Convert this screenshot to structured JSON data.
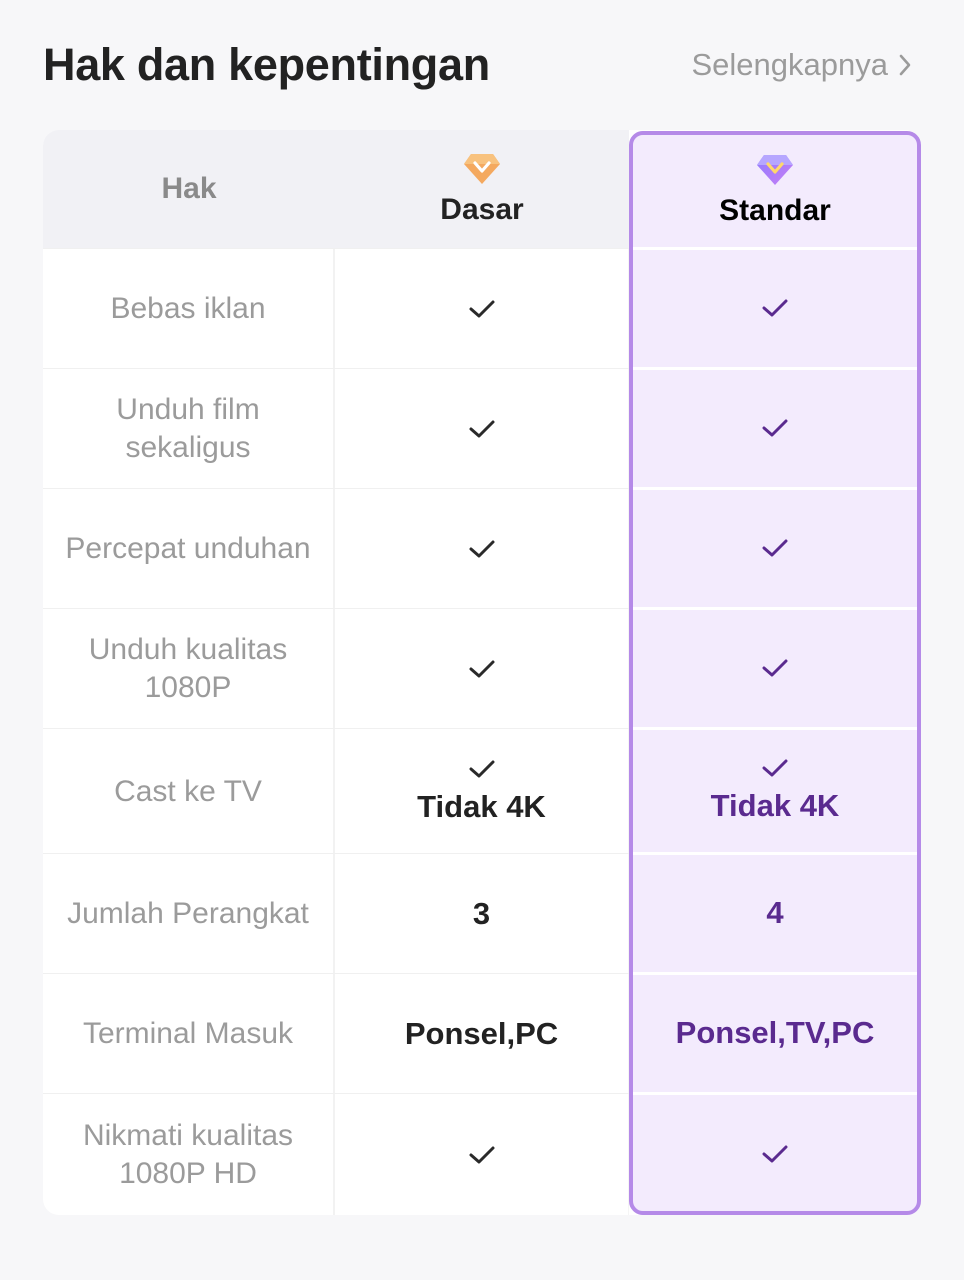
{
  "header": {
    "title": "Hak dan kepentingan",
    "more_label": "Selengkapnya"
  },
  "table": {
    "columns": {
      "rights": "Hak",
      "basic": "Dasar",
      "standard": "Standar"
    },
    "rows": [
      {
        "label": "Bebas iklan",
        "basic": "check",
        "standard": "check"
      },
      {
        "label": "Unduh film sekaligus",
        "basic": "check",
        "standard": "check"
      },
      {
        "label": "Percepat unduhan",
        "basic": "check",
        "standard": "check"
      },
      {
        "label": "Unduh kualitas 1080P",
        "basic": "check",
        "standard": "check"
      },
      {
        "label": "Cast ke TV",
        "basic": "check",
        "basic_text": "Tidak 4K",
        "standard": "check",
        "standard_text": "Tidak 4K"
      },
      {
        "label": "Jumlah Perangkat",
        "basic_text": "3",
        "standard_text": "4"
      },
      {
        "label": "Terminal Masuk",
        "basic_text": "Ponsel,PC",
        "standard_text": "Ponsel,TV,PC"
      },
      {
        "label": "Nikmati kualitas 1080P HD",
        "basic": "check",
        "standard": "check"
      }
    ]
  },
  "icons": {
    "basic_plan": "diamond-orange-icon",
    "standard_plan": "diamond-purple-icon",
    "check": "check-icon",
    "more": "chevron-right-icon"
  },
  "colors": {
    "standard_accent": "#5a2a8f",
    "standard_border": "#b58ae8",
    "standard_bg": "#f3ebfd",
    "basic_diamond": "#f0a05a"
  }
}
